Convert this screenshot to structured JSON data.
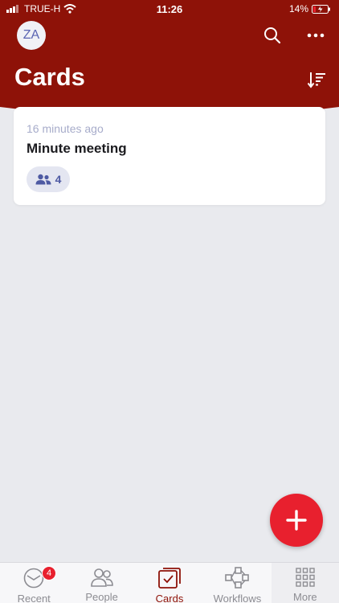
{
  "status_bar": {
    "carrier": "TRUE-H",
    "time": "11:26",
    "battery": "14%"
  },
  "header": {
    "avatar_initials": "ZA",
    "title": "Cards",
    "background_color": "#8e1208"
  },
  "cards": [
    {
      "time_ago": "16 minutes ago",
      "title": "Minute meeting",
      "participants_count": "4"
    }
  ],
  "fab": {
    "icon": "plus-icon",
    "color": "#e8202e"
  },
  "tab_bar": {
    "tabs": [
      {
        "label": "Recent",
        "icon": "clock-mail-icon",
        "badge": "4"
      },
      {
        "label": "People",
        "icon": "people-icon"
      },
      {
        "label": "Cards",
        "icon": "cards-icon",
        "active": true
      },
      {
        "label": "Workflows",
        "icon": "workflow-icon"
      },
      {
        "label": "More",
        "icon": "grid-icon"
      }
    ]
  }
}
